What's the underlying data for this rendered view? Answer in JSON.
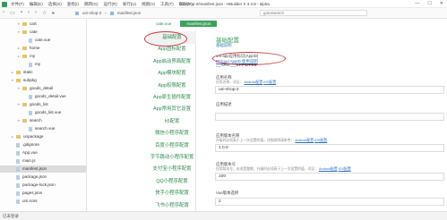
{
  "titlebar": {
    "menu": [
      "文件(F)",
      "编辑(E)",
      "选择(S)",
      "查找(I)",
      "跳转(G)",
      "运行(R)",
      "发行(U)",
      "视图(V)",
      "工具(T)",
      "帮助(Y)"
    ],
    "title": "uni-shop-2/manifest.json - HBuilder X 3.3.8 - alpha",
    "buttons": [
      "—",
      "☐",
      "✕"
    ]
  },
  "toolbar": {
    "breadcrumb": [
      "uni-shop-2",
      "manifest.json"
    ],
    "goto_placeholder": "gotoSearch"
  },
  "tree": [
    {
      "label": "cart",
      "type": "folder",
      "expanded": true,
      "indent": 2
    },
    {
      "label": "cate",
      "type": "folder",
      "expanded": true,
      "indent": 2
    },
    {
      "label": "cate.vue",
      "type": "file",
      "indent": 3
    },
    {
      "label": "home",
      "type": "folder",
      "expanded": false,
      "indent": 2
    },
    {
      "label": "my",
      "type": "folder",
      "expanded": false,
      "indent": 2
    },
    {
      "label": "my",
      "type": "file",
      "indent": 3
    },
    {
      "label": "static",
      "type": "folder",
      "expanded": false,
      "indent": 1
    },
    {
      "label": "subpkg",
      "type": "folder",
      "expanded": true,
      "indent": 1
    },
    {
      "label": "goods_detail",
      "type": "folder",
      "expanded": true,
      "indent": 2
    },
    {
      "label": "goods_detail.vue",
      "type": "file",
      "indent": 3
    },
    {
      "label": "goods_list",
      "type": "folder",
      "expanded": true,
      "indent": 2
    },
    {
      "label": "goods_list.vue",
      "type": "file",
      "indent": 3
    },
    {
      "label": "search",
      "type": "folder",
      "expanded": true,
      "indent": 2
    },
    {
      "label": "search.vue",
      "type": "file",
      "indent": 3
    },
    {
      "label": "unpackage",
      "type": "folder",
      "expanded": false,
      "indent": 1
    },
    {
      "label": ".gitignore",
      "type": "file",
      "indent": 1
    },
    {
      "label": "App.vue",
      "type": "file",
      "indent": 1
    },
    {
      "label": "main.js",
      "type": "file",
      "indent": 1
    },
    {
      "label": "manifest.json",
      "type": "file",
      "indent": 1,
      "selected": true
    },
    {
      "label": "package.json",
      "type": "file",
      "indent": 1
    },
    {
      "label": "package-lock.json",
      "type": "file",
      "indent": 1
    },
    {
      "label": "pages.json",
      "type": "file",
      "indent": 1
    },
    {
      "label": "uni.scss",
      "type": "file",
      "indent": 1
    }
  ],
  "status": "已未登录",
  "tabs": [
    {
      "label": "cate.vue",
      "active": false
    },
    {
      "label": "manifest.json",
      "active": true
    }
  ],
  "nav": [
    "基础配置",
    "App图标配置",
    "App启动界面配置",
    "App模块配置",
    "App权限配置",
    "App原生插件配置",
    "App常用其它设置",
    "h5配置",
    "微信小程序配置",
    "百度小程序配置",
    "字节跳动小程序配置",
    "支付宝小程序配置",
    "QQ小程序配置",
    "快手小程序配置",
    "飞书小程序配置"
  ],
  "main": {
    "section_title": "基础配置",
    "section_link": "基础说明",
    "appid_label": "uni-app应用标识(AppID)",
    "appid_link": "DCloud AppID 使用说明",
    "appid_value": "__UNI__5FFC709",
    "fields": [
      {
        "label": "应用名称",
        "help": "应用名称，详见：",
        "links": [
          "Android配置",
          "iOS配置"
        ],
        "value": "uni-shop-2"
      },
      {
        "label": "应用描述",
        "help": "",
        "links": [],
        "value": ""
      },
      {
        "label": "应用版本名称",
        "help": "升级时必须高于上一次设置的值，详细说明请参考：",
        "links": [
          "Android配置",
          "iOS配置"
        ],
        "value": "1.0.0"
      },
      {
        "label": "应用版本号",
        "help": "应用版本号，必须是整数；升级时必须高于上一次设置的值，详见：",
        "links": [
          "Android配置",
          "iOS配置"
        ],
        "value": "100"
      },
      {
        "label": "Vue版本选择",
        "help": "",
        "links": [],
        "value": "2"
      }
    ]
  },
  "colors": {
    "accent": "#3aa35b",
    "link": "#2a6fc9",
    "highlight_ring": "#d0373f"
  }
}
